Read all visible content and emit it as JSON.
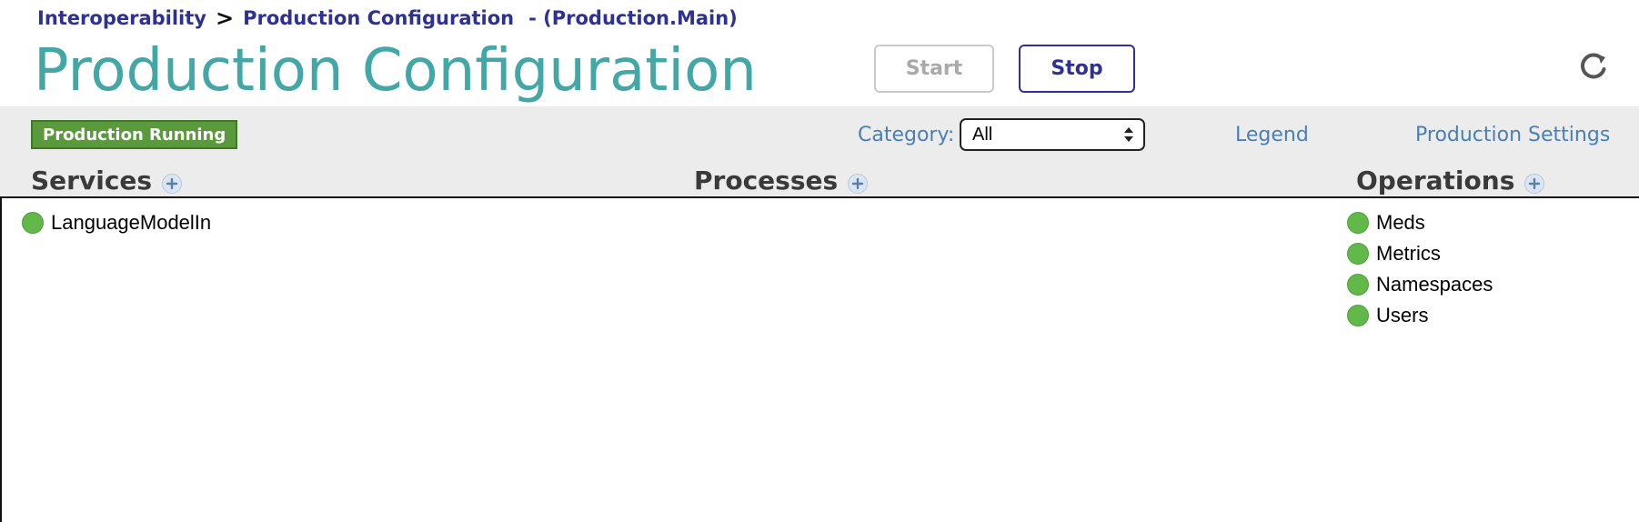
{
  "breadcrumb": {
    "root": "Interoperability",
    "separator": ">",
    "current": "Production Configuration",
    "namespace": "- (Production.Main)"
  },
  "page_title": "Production Configuration",
  "controls": {
    "start_label": "Start",
    "stop_label": "Stop",
    "refresh_icon": "refresh-icon"
  },
  "status": {
    "label": "Production Running",
    "color": "#5b9a3c"
  },
  "category": {
    "label": "Category:",
    "selected": "All"
  },
  "links": {
    "legend": "Legend",
    "settings": "Production Settings"
  },
  "columns": {
    "services": {
      "title": "Services",
      "items": [
        {
          "name": "LanguageModelIn",
          "status_color": "#62b94a"
        }
      ]
    },
    "processes": {
      "title": "Processes",
      "items": []
    },
    "operations": {
      "title": "Operations",
      "items": [
        {
          "name": "Meds",
          "status_color": "#62b94a"
        },
        {
          "name": "Metrics",
          "status_color": "#62b94a"
        },
        {
          "name": "Namespaces",
          "status_color": "#62b94a"
        },
        {
          "name": "Users",
          "status_color": "#62b94a"
        }
      ]
    }
  },
  "colors": {
    "title": "#43a7a5",
    "breadcrumb": "#2e3192",
    "link": "#4a7fb5",
    "toolbar_bg": "#ececec"
  }
}
